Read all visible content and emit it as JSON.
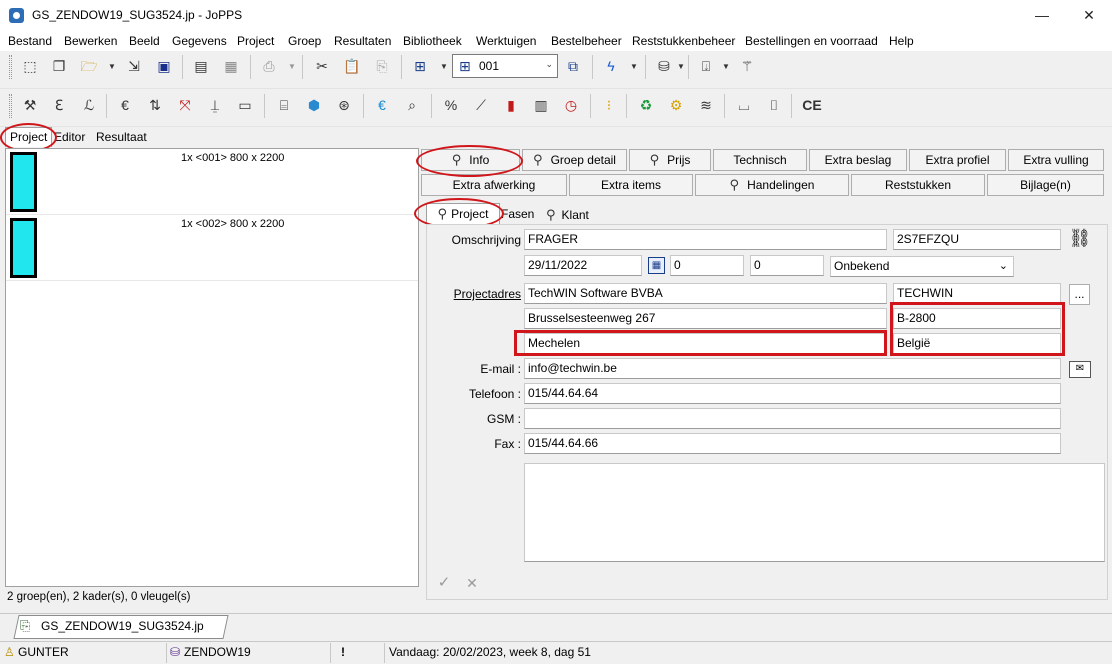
{
  "window": {
    "title": "GS_ZENDOW19_SUG3524.jp - JoPPS",
    "minimize": "—",
    "maximize": "☐",
    "close": "✕"
  },
  "menu": [
    "Bestand",
    "Bewerken",
    "Beeld",
    "Gegevens",
    "Project",
    "Groep",
    "Resultaten",
    "Bibliotheek",
    "Werktuigen",
    "Bestelbeheer",
    "Reststukkenbeheer",
    "Bestellingen en voorraad",
    "Help"
  ],
  "toolbar": {
    "combo_value": "001",
    "ce_label": "CE"
  },
  "left_panel": {
    "tabs": [
      "Project",
      "Editor",
      "Resultaat"
    ],
    "frames": [
      "1x <001> 800 x 2200",
      "1x <002> 800 x 2200"
    ],
    "status": "2 groep(en), 2 kader(s), 0 vleugel(s)"
  },
  "right_panel": {
    "buttons_row1": [
      "Info",
      "Groep detail",
      "Prijs",
      "Technisch",
      "Extra beslag",
      "Extra profiel",
      "Extra vulling"
    ],
    "buttons_row2": [
      "Extra afwerking",
      "Extra items",
      "Handelingen",
      "Reststukken",
      "Bijlage(n)"
    ],
    "tabs": [
      "Project",
      "Fasen",
      "Klant"
    ],
    "form": {
      "omschrijving_label": "Omschrijving",
      "omschrijving": "FRAGER",
      "code": "2S7EFZQU",
      "date": "29/11/2022",
      "num1": "0",
      "num2": "0",
      "status_select": "Onbekend",
      "projectadres_label": "Projectadres",
      "company": "TechWIN Software BVBA",
      "company_short": "TECHWIN",
      "street": "Brusselsesteenweg 267",
      "postal": "B-2800",
      "city": "Mechelen",
      "country": "België",
      "email_label": "E-mail :",
      "email": "info@techwin.be",
      "telefoon_label": "Telefoon :",
      "telefoon": "015/44.64.64",
      "gsm_label": "GSM :",
      "gsm": "",
      "fax_label": "Fax :",
      "fax": "015/44.64.66",
      "more_button": "...",
      "ok_icon": "✓",
      "cancel_icon": "✕"
    }
  },
  "file_tab": "GS_ZENDOW19_SUG3524.jp",
  "statusbar": {
    "user": "GUNTER",
    "database": "ZENDOW19",
    "alert": "!",
    "today": "Vandaag: 20/02/2023, week 8, dag 51"
  }
}
